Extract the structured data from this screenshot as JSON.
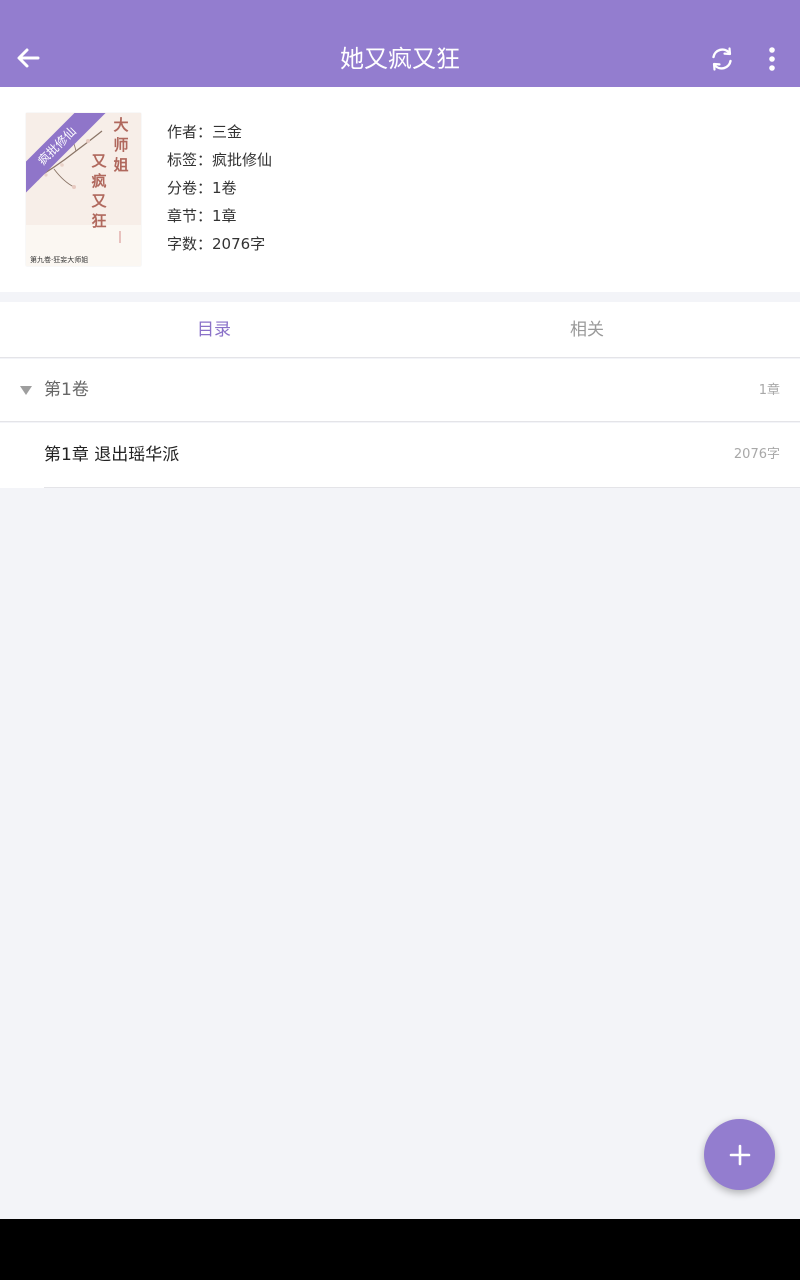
{
  "app_bar": {
    "title": "她又疯又狂",
    "back_icon": "arrow-left-icon",
    "sync_icon": "sync-icon",
    "more_icon": "more-vert-icon",
    "background": "#937dcf"
  },
  "book": {
    "cover": {
      "banner": "疯批修仙",
      "title_col1": "大师姐",
      "title_col2": "又疯又狂",
      "bottom_text": "第九卷·狂妄大师姐"
    },
    "author": "作者：三金",
    "tags": "标签：疯批修仙",
    "volumes": "分卷：1卷",
    "chapters": "章节：1章",
    "words": "字数：2076字"
  },
  "tabs": [
    {
      "label": "目录",
      "active": true
    },
    {
      "label": "相关",
      "active": false
    }
  ],
  "toc": {
    "volume": {
      "name": "第1卷",
      "count": "1章"
    },
    "chapters": [
      {
        "name": "第1章  退出瑶华派",
        "count": "2076字"
      }
    ]
  },
  "fab": {
    "icon": "plus-icon"
  },
  "colors": {
    "accent": "#937dcf",
    "tab_active": "#8a71c8"
  }
}
